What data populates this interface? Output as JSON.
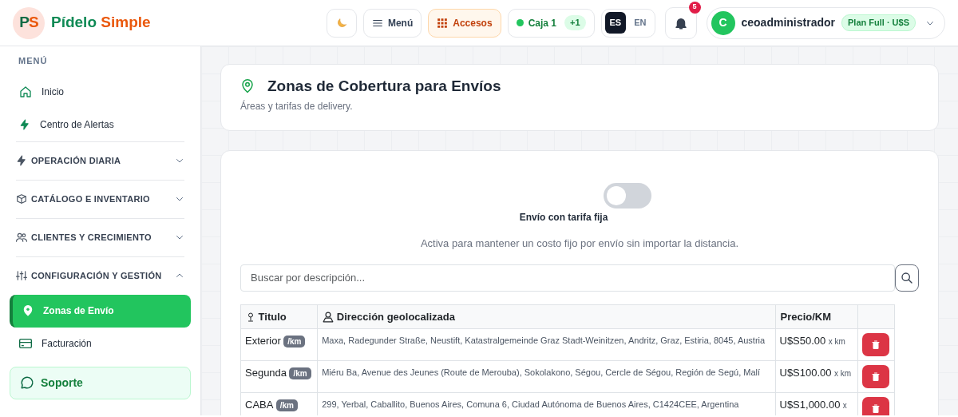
{
  "brand": {
    "logo_text": "PS",
    "name_first": "Pídelo",
    "name_second": "Simple"
  },
  "topbar": {
    "menu_label": "Menú",
    "access_label": "Accesos",
    "cash": {
      "label": "Caja 1",
      "count": "+1",
      "color": "#22c55e"
    },
    "languages": [
      {
        "label": "ES",
        "selected": true
      },
      {
        "label": "EN",
        "selected": false
      }
    ],
    "notifications": "5",
    "user": {
      "initial": "C",
      "name": "ceoadministrador",
      "plan": "Plan Full · U$S"
    }
  },
  "sidebar": {
    "heading": "MENÚ",
    "items": [
      {
        "label": "Inicio"
      },
      {
        "label": "Centro de Alertas"
      }
    ],
    "sections": [
      {
        "label": "OPERACIÓN DIARIA",
        "expanded": false
      },
      {
        "label": "CATÁLOGO E INVENTARIO",
        "expanded": false
      },
      {
        "label": "CLIENTES Y CRECIMIENTO",
        "expanded": false
      },
      {
        "label": "CONFIGURACIÓN Y GESTIÓN",
        "expanded": true,
        "children": [
          {
            "label": "Zonas de Envío",
            "selected": true
          },
          {
            "label": "Facturación",
            "selected": false
          }
        ]
      }
    ],
    "support": "Soporte"
  },
  "page": {
    "title": "Zonas de Cobertura para Envíos",
    "subtitle": "Áreas y tarifas de delivery."
  },
  "fixed_rate": {
    "label": "Envío con tarifa fija",
    "on": false,
    "description": "Activa para mantener un costo fijo por envío sin importar la distancia."
  },
  "search": {
    "placeholder": "Buscar por descripción..."
  },
  "table": {
    "columns": [
      "Titulo",
      "Dirección geolocalizada",
      "Precio/KM"
    ],
    "rows": [
      {
        "title": "Exterior",
        "badge": "/km",
        "address": "Maxa, Radegunder Straße, Neustift, Katastralgemeinde Graz Stadt-Weinitzen, Andritz, Graz, Estiria, 8045, Austria",
        "price": "U$S50.00",
        "unit": "x km"
      },
      {
        "title": "Segunda",
        "badge": "/km",
        "address": "Miéru Ba, Avenue des Jeunes (Route de Merouba), Sokolakono, Ségou, Cercle de Ségou, Región de Segú, Malí",
        "price": "U$S100.00",
        "unit": "x km"
      },
      {
        "title": "CABA",
        "badge": "/km",
        "address": "299, Yerbal, Caballito, Buenos Aires, Comuna 6, Ciudad Autónoma de Buenos Aires, C1424CEE, Argentina",
        "price": "U$S1,000.00",
        "unit": "x"
      }
    ]
  }
}
